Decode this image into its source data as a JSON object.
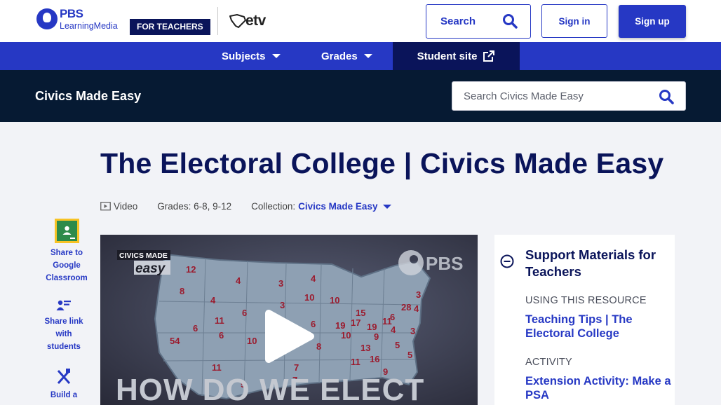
{
  "header": {
    "logo_main": "PBS",
    "logo_sub": "LearningMedia",
    "badge": "FOR TEACHERS",
    "partner_logo": "etv",
    "search_label": "Search",
    "signin_label": "Sign in",
    "signup_label": "Sign up"
  },
  "nav": {
    "subjects": "Subjects",
    "grades": "Grades",
    "student_site": "Student site"
  },
  "collection": {
    "title": "Civics Made Easy",
    "search_placeholder": "Search Civics Made Easy"
  },
  "page": {
    "title": "The Electoral College | Civics Made Easy",
    "meta": {
      "type": "Video",
      "grades": "Grades: 6-8, 9-12",
      "collection_label": "Collection:",
      "collection_value": "Civics Made Easy"
    }
  },
  "share": {
    "classroom": "Share to Google Classroom",
    "students": "Share link with students",
    "build": "Build a"
  },
  "video": {
    "badge_top": "CIVICS MADE",
    "badge_bottom": "easy",
    "watermark": "PBS",
    "caption": "HOW DO WE ELECT",
    "map_numbers": [
      "12",
      "4",
      "3",
      "4",
      "10",
      "10",
      "15",
      "28",
      "8",
      "4",
      "3",
      "6",
      "19",
      "11",
      "17",
      "19",
      "4",
      "3",
      "11",
      "6",
      "6",
      "10",
      "10",
      "8",
      "13",
      "5",
      "54",
      "6",
      "7",
      "11",
      "9",
      "5",
      "7",
      "11",
      "16",
      "5",
      "9",
      "6",
      "3",
      "4"
    ]
  },
  "support": {
    "title": "Support Materials for Teachers",
    "sections": [
      {
        "label": "USING THIS RESOURCE",
        "link": "Teaching Tips | The Electoral College"
      },
      {
        "label": "ACTIVITY",
        "link": "Extension Activity: Make a PSA"
      }
    ]
  },
  "colors": {
    "brand_blue": "#2638c4",
    "navy": "#0a145a",
    "dark_bar": "#061a33",
    "page_bg": "#f2f3f7"
  }
}
